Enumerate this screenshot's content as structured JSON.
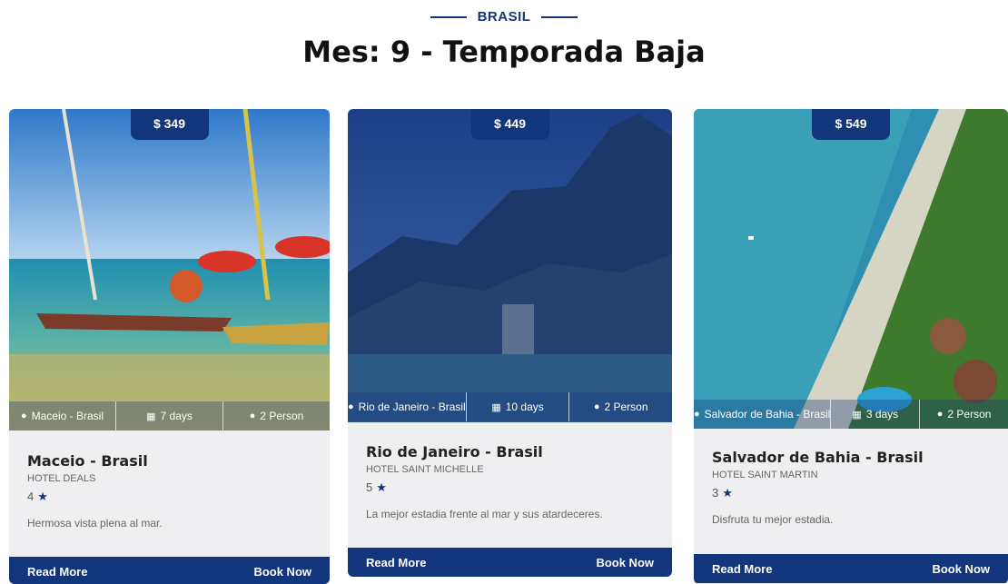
{
  "section": {
    "subtitle": "BRASIL",
    "title": "Mes: 9 - Temporada Baja"
  },
  "cards": [
    {
      "price": "$ 349",
      "location": "Maceio - Brasil",
      "duration": "7 days",
      "persons": "2 Person",
      "name": "Maceio - Brasil",
      "hotel": "HOTEL DEALS",
      "rating": "4",
      "description": "Hermosa vista plena al mar.",
      "read_more": "Read More",
      "book_now": "Book Now"
    },
    {
      "price": "$ 449",
      "location": "Rio de Janeiro - Brasil",
      "duration": "10 days",
      "persons": "2 Person",
      "name": "Rio de Janeiro - Brasil",
      "hotel": "HOTEL SAINT MICHELLE",
      "rating": "5",
      "description": "La mejor estadia frente al mar y sus atardeceres.",
      "read_more": "Read More",
      "book_now": "Book Now"
    },
    {
      "price": "$ 549",
      "location": "Salvador de Bahia - Brasil",
      "duration": "3 days",
      "persons": "2 Person",
      "name": "Salvador de Bahia - Brasil",
      "hotel": "HOTEL SAINT MARTIN",
      "rating": "3",
      "description": "Disfruta tu mejor estadia.",
      "read_more": "Read More",
      "book_now": "Book Now"
    }
  ],
  "icons": {
    "location": "map-pin-icon",
    "duration": "calendar-icon",
    "persons": "person-icon",
    "rating": "star-icon"
  },
  "colors": {
    "accent": "#13357b"
  }
}
